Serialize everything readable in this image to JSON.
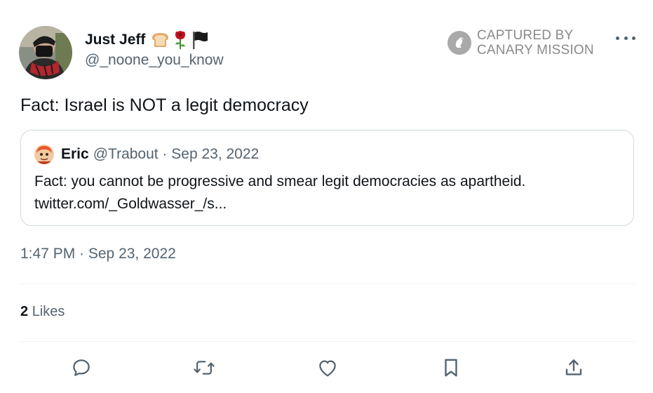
{
  "author": {
    "name": "Just Jeff",
    "handle": "@_noone_you_know",
    "emoji_icons": [
      "bread-icon",
      "rose-icon",
      "black-flag-icon"
    ]
  },
  "watermark": {
    "line1": "CAPTURED BY",
    "line2": "CANARY MISSION"
  },
  "tweet": {
    "text": "Fact: Israel is NOT a legit democracy",
    "timestamp": "1:47 PM · Sep 23, 2022"
  },
  "quoted_tweet": {
    "name": "Eric",
    "meta": "@Trabout · Sep 23, 2022",
    "text_line1": "Fact: you cannot be progressive and smear legit democracies as apartheid.",
    "text_line2": "twitter.com/_Goldwasser_/s..."
  },
  "stats": {
    "likes_count": "2",
    "likes_label": "Likes"
  },
  "actions": [
    "reply-icon",
    "retweet-icon",
    "like-icon",
    "bookmark-icon",
    "share-icon"
  ],
  "colors": {
    "primary_text": "#0f1419",
    "secondary_text": "#536471",
    "border": "#cfd9de",
    "divider": "#eff3f4"
  }
}
